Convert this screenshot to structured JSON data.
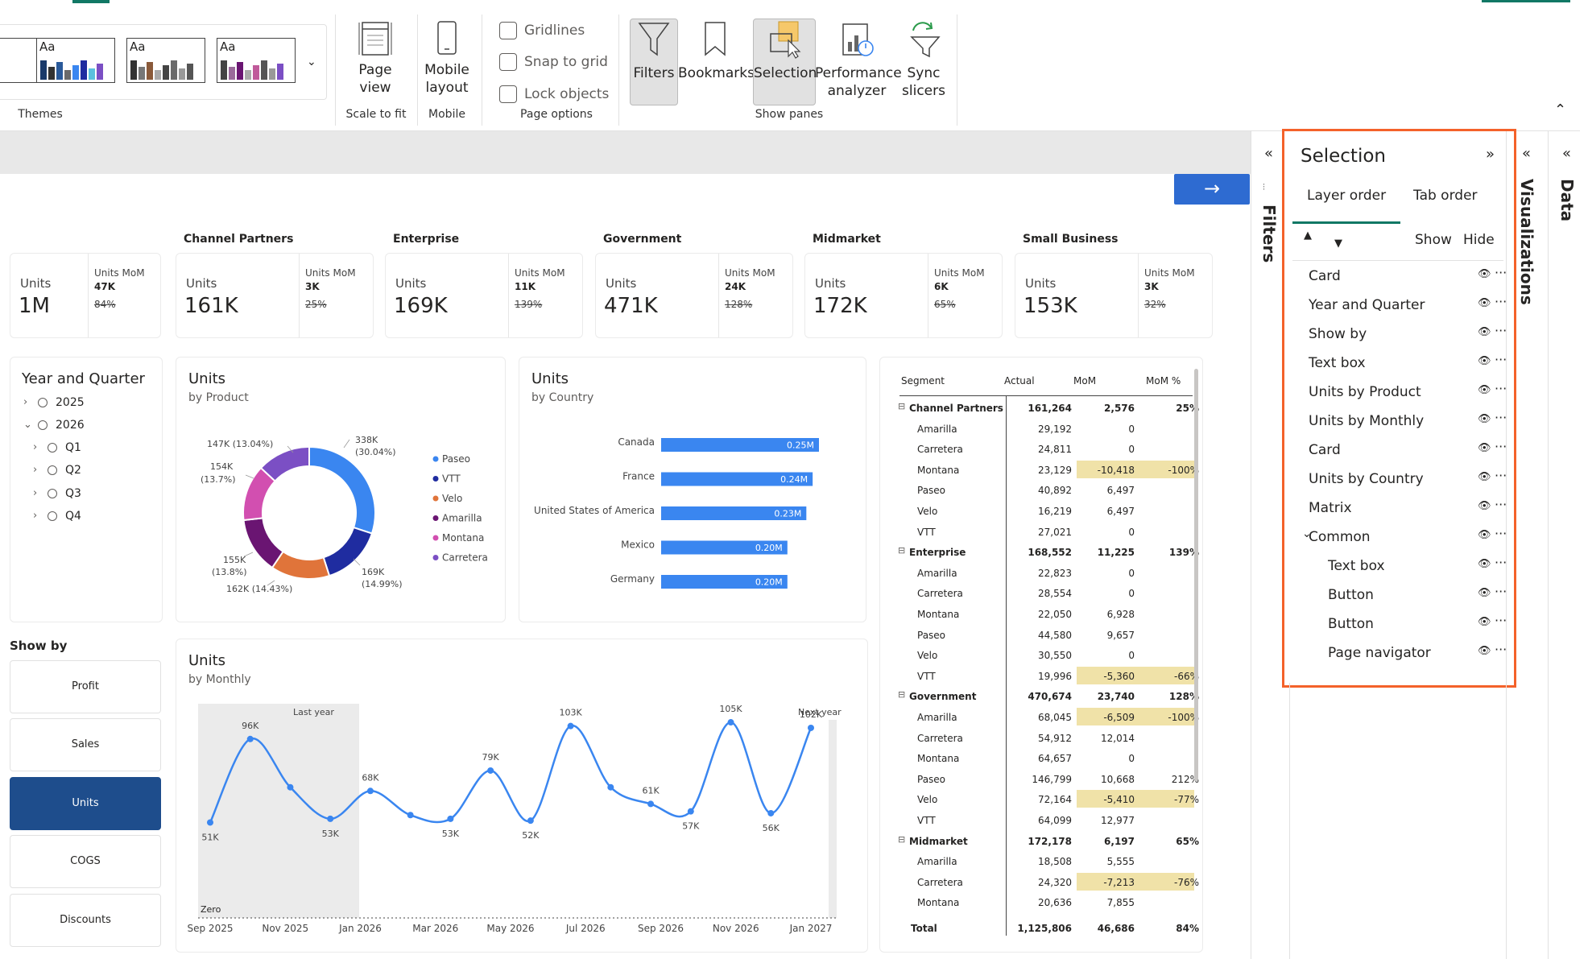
{
  "ribbon": {
    "themes_label": "Themes",
    "theme_tiles": [
      {
        "label": "Aa"
      },
      {
        "label": "Aa"
      },
      {
        "label": "Aa"
      }
    ],
    "page_view_label": "Page view",
    "scale_to_fit_label": "Scale to fit",
    "mobile_layout_label": "Mobile layout",
    "mobile_group_label": "Mobile",
    "gridlines_label": "Gridlines",
    "snap_label": "Snap to grid",
    "lock_label": "Lock objects",
    "page_options_label": "Page options",
    "filters_label": "Filters",
    "bookmarks_label": "Bookmarks",
    "selection_label": "Selection",
    "perf_label": "Performance analyzer",
    "sync_label": "Sync slicers",
    "show_panes_label": "Show panes"
  },
  "kpis": [
    {
      "title": "",
      "units_label": "Units",
      "value": "1M",
      "mom_label": "Units MoM",
      "mom": "47K",
      "pct": "84%"
    },
    {
      "title": "Channel Partners",
      "units_label": "Units",
      "value": "161K",
      "mom_label": "Units MoM",
      "mom": "3K",
      "pct": "25%"
    },
    {
      "title": "Enterprise",
      "units_label": "Units",
      "value": "169K",
      "mom_label": "Units MoM",
      "mom": "11K",
      "pct": "139%"
    },
    {
      "title": "Government",
      "units_label": "Units",
      "value": "471K",
      "mom_label": "Units MoM",
      "mom": "24K",
      "pct": "128%"
    },
    {
      "title": "Midmarket",
      "units_label": "Units",
      "value": "172K",
      "mom_label": "Units MoM",
      "mom": "6K",
      "pct": "65%"
    },
    {
      "title": "Small Business",
      "units_label": "Units",
      "value": "153K",
      "mom_label": "Units MoM",
      "mom": "3K",
      "pct": "32%"
    }
  ],
  "slicer": {
    "title": "Year and Quarter",
    "items": [
      {
        "label": "2025",
        "chev": "›"
      },
      {
        "label": "2026",
        "chev": "⌄"
      },
      {
        "label": "Q1",
        "chev": "›"
      },
      {
        "label": "Q2",
        "chev": "›"
      },
      {
        "label": "Q3",
        "chev": "›"
      },
      {
        "label": "Q4",
        "chev": "›"
      }
    ]
  },
  "showby": {
    "title": "Show by",
    "buttons": [
      "Profit",
      "Sales",
      "Units",
      "COGS",
      "Discounts"
    ],
    "selected": "Units"
  },
  "donut": {
    "title": "Units",
    "subtitle": "by Product",
    "labels": [
      "338K",
      "(30.04%)",
      "169K",
      "(14.99%)",
      "162K (14.43%)",
      "155K",
      "(13.8%)",
      "154K",
      "(13.7%)",
      "147K (13.04%)"
    ]
  },
  "country": {
    "title": "Units",
    "subtitle": "by Country"
  },
  "monthly": {
    "title": "Units",
    "subtitle": "by Monthly",
    "last_year_label": "Last year",
    "next_year_label": "Next year",
    "zero_label": "Zero"
  },
  "matrix": {
    "headers": [
      "Segment",
      "Actual",
      "MoM",
      "MoM %"
    ],
    "rows": [
      {
        "label": "Channel Partners",
        "actual": "161,264",
        "mom": "2,576",
        "pct": "25%",
        "level": 0,
        "hl": false
      },
      {
        "label": "Amarilla",
        "actual": "29,192",
        "mom": "0",
        "pct": "",
        "level": 1,
        "hl": false
      },
      {
        "label": "Carretera",
        "actual": "24,811",
        "mom": "0",
        "pct": "",
        "level": 1,
        "hl": false
      },
      {
        "label": "Montana",
        "actual": "23,129",
        "mom": "-10,418",
        "pct": "-100%",
        "level": 1,
        "hl": true
      },
      {
        "label": "Paseo",
        "actual": "40,892",
        "mom": "6,497",
        "pct": "",
        "level": 1,
        "hl": false
      },
      {
        "label": "Velo",
        "actual": "16,219",
        "mom": "6,497",
        "pct": "",
        "level": 1,
        "hl": false
      },
      {
        "label": "VTT",
        "actual": "27,021",
        "mom": "0",
        "pct": "",
        "level": 1,
        "hl": false
      },
      {
        "label": "Enterprise",
        "actual": "168,552",
        "mom": "11,225",
        "pct": "139%",
        "level": 0,
        "hl": false
      },
      {
        "label": "Amarilla",
        "actual": "22,823",
        "mom": "0",
        "pct": "",
        "level": 1,
        "hl": false
      },
      {
        "label": "Carretera",
        "actual": "28,554",
        "mom": "0",
        "pct": "",
        "level": 1,
        "hl": false
      },
      {
        "label": "Montana",
        "actual": "22,050",
        "mom": "6,928",
        "pct": "",
        "level": 1,
        "hl": false
      },
      {
        "label": "Paseo",
        "actual": "44,580",
        "mom": "9,657",
        "pct": "",
        "level": 1,
        "hl": false
      },
      {
        "label": "Velo",
        "actual": "30,550",
        "mom": "0",
        "pct": "",
        "level": 1,
        "hl": false
      },
      {
        "label": "VTT",
        "actual": "19,996",
        "mom": "-5,360",
        "pct": "-66%",
        "level": 1,
        "hl": true
      },
      {
        "label": "Government",
        "actual": "470,674",
        "mom": "23,740",
        "pct": "128%",
        "level": 0,
        "hl": false
      },
      {
        "label": "Amarilla",
        "actual": "68,045",
        "mom": "-6,509",
        "pct": "-100%",
        "level": 1,
        "hl": true
      },
      {
        "label": "Carretera",
        "actual": "54,912",
        "mom": "12,014",
        "pct": "",
        "level": 1,
        "hl": false
      },
      {
        "label": "Montana",
        "actual": "64,657",
        "mom": "0",
        "pct": "",
        "level": 1,
        "hl": false
      },
      {
        "label": "Paseo",
        "actual": "146,799",
        "mom": "10,668",
        "pct": "212%",
        "level": 1,
        "hl": false
      },
      {
        "label": "Velo",
        "actual": "72,164",
        "mom": "-5,410",
        "pct": "-77%",
        "level": 1,
        "hl": true
      },
      {
        "label": "VTT",
        "actual": "64,099",
        "mom": "12,977",
        "pct": "",
        "level": 1,
        "hl": false
      },
      {
        "label": "Midmarket",
        "actual": "172,178",
        "mom": "6,197",
        "pct": "65%",
        "level": 0,
        "hl": false
      },
      {
        "label": "Amarilla",
        "actual": "18,508",
        "mom": "5,555",
        "pct": "",
        "level": 1,
        "hl": false
      },
      {
        "label": "Carretera",
        "actual": "24,320",
        "mom": "-7,213",
        "pct": "-76%",
        "level": 1,
        "hl": true
      },
      {
        "label": "Montana",
        "actual": "20,636",
        "mom": "7,855",
        "pct": "",
        "level": 1,
        "hl": false
      }
    ],
    "total": {
      "label": "Total",
      "actual": "1,125,806",
      "mom": "46,686",
      "pct": "84%"
    }
  },
  "panes": {
    "filters_label": "Filters",
    "visualizations_label": "Visualizations",
    "data_label": "Data",
    "collapse_icon": "«"
  },
  "selection_pane": {
    "title": "Selection",
    "tab_layer": "Layer order",
    "tab_tab": "Tab order",
    "show_label": "Show",
    "hide_label": "Hide",
    "layers": [
      {
        "name": "Card",
        "indent": 0
      },
      {
        "name": "Year and Quarter",
        "indent": 0
      },
      {
        "name": "Show by",
        "indent": 0
      },
      {
        "name": "Text box",
        "indent": 0
      },
      {
        "name": "Units by Product",
        "indent": 0
      },
      {
        "name": "Units by Monthly",
        "indent": 0
      },
      {
        "name": "Card",
        "indent": 0
      },
      {
        "name": "Units by Country",
        "indent": 0
      },
      {
        "name": "Matrix",
        "indent": 0
      },
      {
        "name": "Common",
        "indent": 0,
        "group": true
      },
      {
        "name": "Text box",
        "indent": 1
      },
      {
        "name": "Button",
        "indent": 1
      },
      {
        "name": "Button",
        "indent": 1
      },
      {
        "name": "Page navigator",
        "indent": 1
      }
    ]
  },
  "chart_data": [
    {
      "type": "pie",
      "title": "Units",
      "subtitle": "by Product",
      "categories": [
        "Paseo",
        "VTT",
        "Velo",
        "Amarilla",
        "Montana",
        "Carretera"
      ],
      "values": [
        338,
        169,
        162,
        155,
        154,
        147
      ],
      "percents": [
        30.04,
        14.99,
        14.43,
        13.8,
        13.7,
        13.04
      ],
      "colors": [
        "#3a86f0",
        "#1f2ca0",
        "#e0743a",
        "#6a1572",
        "#d24fb0",
        "#7b4fc4"
      ],
      "legend": "right"
    },
    {
      "type": "bar",
      "title": "Units",
      "subtitle": "by Country",
      "orientation": "horizontal",
      "categories": [
        "Canada",
        "France",
        "United States of America",
        "Mexico",
        "Germany"
      ],
      "values": [
        0.25,
        0.24,
        0.23,
        0.2,
        0.2
      ],
      "labels": [
        "0.25M",
        "0.24M",
        "0.23M",
        "0.20M",
        "0.20M"
      ],
      "color": "#3a86f0"
    },
    {
      "type": "line",
      "title": "Units",
      "subtitle": "by Monthly",
      "x": [
        "Sep 2025",
        "Oct 2025",
        "Nov 2025",
        "Dec 2025",
        "Jan 2026",
        "Feb 2026",
        "Mar 2026",
        "Apr 2026",
        "May 2026",
        "Jun 2026",
        "Jul 2026",
        "Aug 2026",
        "Sep 2026",
        "Oct 2026",
        "Nov 2026",
        "Dec 2026"
      ],
      "values": [
        51,
        96,
        70,
        53,
        68,
        55,
        53,
        79,
        52,
        103,
        70,
        61,
        57,
        105,
        56,
        102
      ],
      "point_labels": [
        "51K",
        "96K",
        "",
        "53K",
        "68K",
        "",
        "53K",
        "79K",
        "52K",
        "103K",
        "",
        "61K",
        "57K",
        "105K",
        "56K",
        "102K"
      ],
      "xticks": [
        "Sep 2025",
        "Nov 2025",
        "Jan 2026",
        "Mar 2026",
        "May 2026",
        "Jul 2026",
        "Sep 2026",
        "Nov 2026",
        "Jan 2027"
      ],
      "ylim": [
        0,
        115
      ],
      "color": "#3a86f0"
    }
  ]
}
